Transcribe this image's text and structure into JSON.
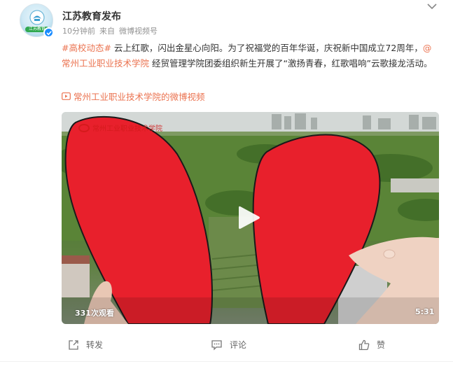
{
  "post": {
    "author": "江苏教育发布",
    "avatar_badge": "江苏教育",
    "time": "10分钟前",
    "source_prefix": "来自",
    "source": "微博视频号",
    "hashtag": "#高校动态#",
    "text_part1": " 云上红歌，闪出金星心向阳。为了祝福党的百年华诞，庆祝新中国成立72周年，",
    "mention": "@常州工业职业技术学院",
    "text_part2": " 经贸管理学院团委组织新生开展了“激扬青春，红歌唱响”云歌接龙活动。",
    "video_link": "常州工业职业技术学院的微博视频"
  },
  "video": {
    "views": "331次观看",
    "duration": "5:31",
    "watermark": "常州工业职业技术学院"
  },
  "actions": {
    "share": "转发",
    "comment": "评论",
    "like": "赞"
  },
  "colors": {
    "accent": "#eb7350",
    "verified": "#1a8cff",
    "heart_red": "#e8202c"
  },
  "icons": [
    "more-chevron-icon",
    "verified-icon",
    "video-icon",
    "play-icon",
    "share-icon",
    "comment-icon",
    "like-icon"
  ]
}
